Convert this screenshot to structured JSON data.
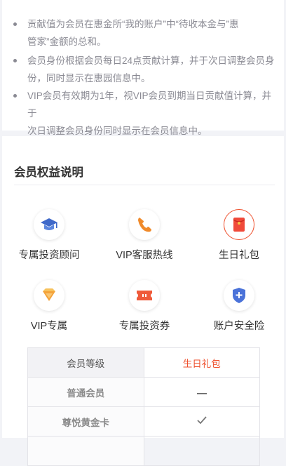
{
  "notes": {
    "items": [
      {
        "line1": "贡献值为会员在惠金所“我的账户”中“待收本金与”惠",
        "line2": "管家”金额的总和。"
      },
      {
        "line1": "会员身份根据会员每日24点贡献计算，并于次日调整会员身",
        "line2": "份，同时显示在惠园信息中。"
      },
      {
        "line1": "VIP会员有效期为1年，视VIP会员到期当日贡献值计算，并于",
        "line2": "次日调整会员身份同时显示在会员信息中。"
      }
    ]
  },
  "benefits_section": {
    "title": "会员权益说明",
    "items": [
      {
        "label": "专属投资顾问",
        "icon": "graduation-cap-icon"
      },
      {
        "label": "VIP客服热线",
        "icon": "phone-icon"
      },
      {
        "label": "生日礼包",
        "icon": "red-envelope-icon",
        "selected": true
      },
      {
        "label": "VIP专属",
        "icon": "diamond-icon"
      },
      {
        "label": "专属投资券",
        "icon": "ticket-icon"
      },
      {
        "label": "账户安全险",
        "icon": "shield-plus-icon"
      }
    ]
  },
  "levels_table": {
    "header_left": "会员等级",
    "header_right": "生日礼包",
    "rows": [
      {
        "level": "普通会员",
        "value": "—",
        "value_icon": "dash-icon"
      },
      {
        "level": "尊悦黄金卡",
        "value": "✓",
        "value_icon": "check-icon"
      }
    ]
  },
  "colors": {
    "accent": "#ee4f2c",
    "text_primary": "#333333",
    "text_secondary": "#8a8a93",
    "page_bg": "#f2f3f7"
  }
}
